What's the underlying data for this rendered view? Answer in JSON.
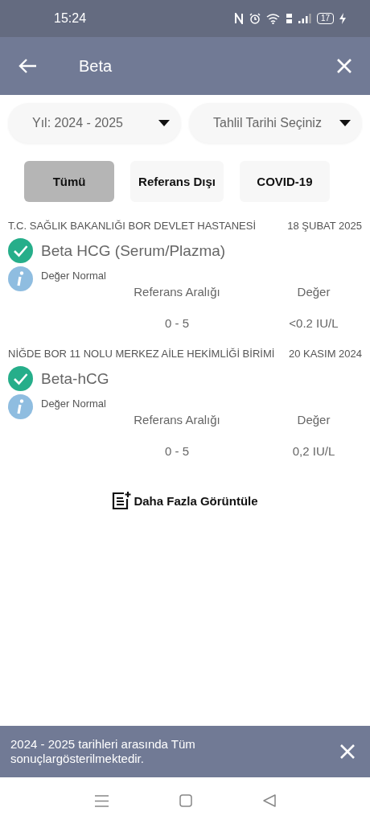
{
  "status_bar": {
    "time": "15:24",
    "battery": "17"
  },
  "app_bar": {
    "title": "Beta"
  },
  "dropdowns": [
    {
      "value": "Yıl: 2024 - 2025"
    },
    {
      "placeholder": "Tahlil Tarihi Seçiniz"
    }
  ],
  "filters": [
    {
      "label": "Tümü",
      "selected": true
    },
    {
      "label": "Referans Dışı",
      "selected": false
    },
    {
      "label": "COVID-19",
      "selected": false
    }
  ],
  "results": [
    {
      "institution": "T.C. SAĞLIK BAKANLIĞI BOR DEVLET HASTANESİ",
      "date": "18 ŞUBAT 2025",
      "test": "Beta HCG (Serum/Plazma)",
      "status": "Değer Normal",
      "range_header": "Referans Aralığı",
      "value_header": "Değer",
      "range": "0 - 5",
      "value": "<0.2 IU/L"
    },
    {
      "institution": "NİĞDE BOR 11 NOLU MERKEZ AİLE HEKİMLİĞİ BİRİMİ",
      "date": "20 KASIM 2024",
      "test": "Beta-hCG",
      "status": "Değer Normal",
      "range_header": "Referans Aralığı",
      "value_header": "Değer",
      "range": "0 - 5",
      "value": "0,2 IU/L"
    }
  ],
  "more_button": {
    "label": "Daha Fazla Görüntüle"
  },
  "snackbar": {
    "message": "2024 - 2025 tarihleri arasında Tüm sonuçlargösterilmektedir."
  }
}
